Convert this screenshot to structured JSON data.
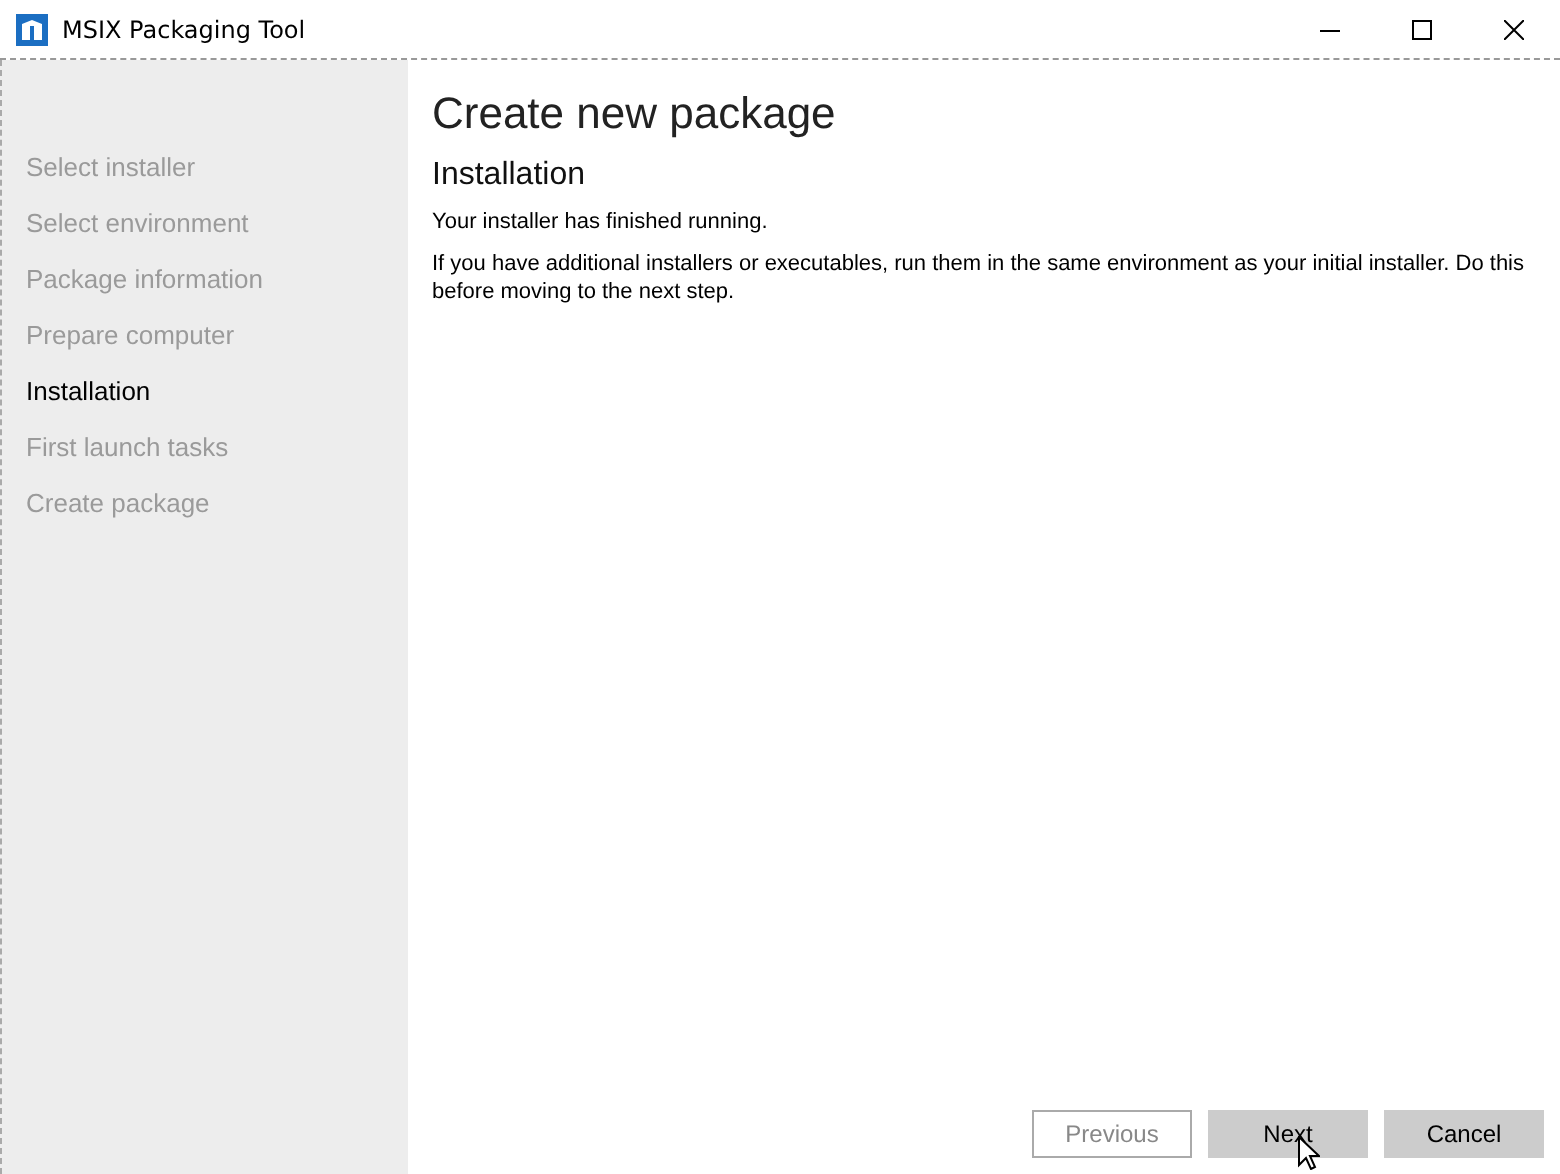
{
  "window": {
    "title": "MSIX Packaging Tool"
  },
  "sidebar": {
    "items": [
      {
        "label": "Select installer",
        "selected": false
      },
      {
        "label": "Select environment",
        "selected": false
      },
      {
        "label": "Package information",
        "selected": false
      },
      {
        "label": "Prepare computer",
        "selected": false
      },
      {
        "label": "Installation",
        "selected": true
      },
      {
        "label": "First launch tasks",
        "selected": false
      },
      {
        "label": "Create package",
        "selected": false
      }
    ]
  },
  "main": {
    "title": "Create new package",
    "section": "Installation",
    "paragraphs": [
      "Your installer has finished running.",
      "If you have additional installers or executables, run them in the same environment as your initial installer. Do this before moving to the next step."
    ]
  },
  "buttons": [
    {
      "label": "Previous",
      "disabled": true
    },
    {
      "label": "Next",
      "disabled": false
    },
    {
      "label": "Cancel",
      "disabled": false
    }
  ]
}
